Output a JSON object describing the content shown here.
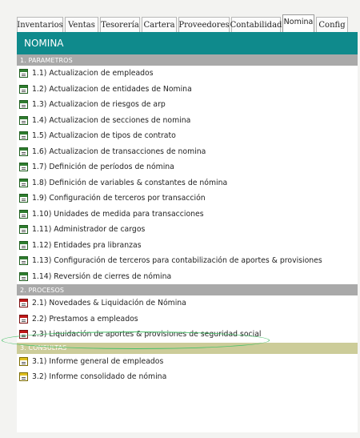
{
  "tabs": [
    {
      "label": "Inventarios",
      "w": 58
    },
    {
      "label": "Ventas",
      "w": 42
    },
    {
      "label": "Tesorería",
      "w": 50
    },
    {
      "label": "Cartera",
      "w": 44
    },
    {
      "label": "Proveedores",
      "w": 64
    },
    {
      "label": "Contabilidad",
      "w": 62
    },
    {
      "label": "Nomina",
      "w": 40,
      "active": true
    },
    {
      "label": "Config",
      "w": 40
    }
  ],
  "panel_title": "NOMINA",
  "sections": [
    {
      "label": "1. PARAMETROS",
      "color": "gray",
      "icon": "green",
      "items": [
        "1.1) Actualizacion de empleados",
        "1.2) Actualizacion de entidades de Nomina",
        "1.3) Actualizacion de riesgos de arp",
        "1.4) Actualizacion de secciones de nomina",
        "1.5) Actualizacion de tipos de contrato",
        "1.6) Actualizacion de transacciones de nomina",
        "1.7) Definición de períodos de nómina",
        "1.8) Definición de variables & constantes de nómina",
        "1.9) Configuración de terceros por transacción",
        "1.10) Unidades de medida para transacciones",
        "1.11) Administrador de cargos",
        "1.12) Entidades pra libranzas",
        "1.13) Configuración de terceros para contabilización de aportes & provisiones",
        "1.14) Reversión de cierres de nómina"
      ]
    },
    {
      "label": "2. PROCESOS",
      "color": "gray",
      "icon": "red",
      "items": [
        "2.1) Novedades & Liquidación de Nómina",
        "2.2) Prestamos a empleados",
        "2.3) Liquidación de aportes & provisiones de seguridad social"
      ]
    },
    {
      "label": "3. CONSULTAS",
      "color": "yellow",
      "icon": "yellow",
      "items": [
        "3.1) Informe general de empleados",
        "3.2) Informe consolidado de nómina"
      ]
    }
  ]
}
